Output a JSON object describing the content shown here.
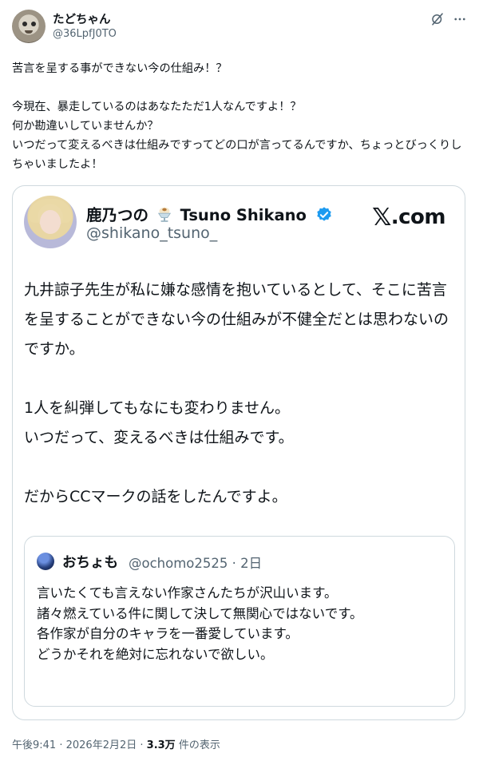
{
  "author": {
    "name": "たどちゃん",
    "handle": "@36LpfJ0TO"
  },
  "icons": [
    "grok-icon",
    "more-icon",
    "verified-icon",
    "parfait-icon"
  ],
  "tweet": {
    "text": "苦言を呈する事ができない今の仕組み！？\n\n今現在、暴走しているのはあなたただ1人なんですよ！？\n何か勘違いしていませんか？\nいつだって変えるべきは仕組みですってどの口が言ってるんですか、ちょっとびっくりしちゃいましたよ！"
  },
  "embed": {
    "name_part1": "鹿乃つの",
    "name_part2": "Tsuno Shikano",
    "handle": "@shikano_tsuno_",
    "brand": ".com",
    "brand_glyph": "𝕏",
    "body": "九井諒子先生が私に嫌な感情を抱いているとして、そこに苦言を呈することができない今の仕組みが不健全だとは思わないのですか。\n\n1人を糾弾してもなにも変わりません。\nいつだって、変えるべきは仕組みです。\n\nだからCCマークの話をしたんですよ。",
    "quote": {
      "name": "おちょも",
      "meta": "@ochomo2525 · 2日",
      "body": "言いたくても言えない作家さんたちが沢山います。\n諸々燃えている件に関して決して無関心ではないです。\n各作家が自分のキャラを一番愛しています。\nどうかそれを絶対に忘れないで欲しい。"
    }
  },
  "footer": {
    "time": "午後9:41",
    "sep1": " · ",
    "date": "2026年2月2日",
    "sep2": " · ",
    "views": "3.3万",
    "views_label": " 件の表示"
  },
  "colors": {
    "text": "#0f1419",
    "secondary": "#536471",
    "border": "#cfd9de",
    "verified": "#1d9bf0"
  }
}
